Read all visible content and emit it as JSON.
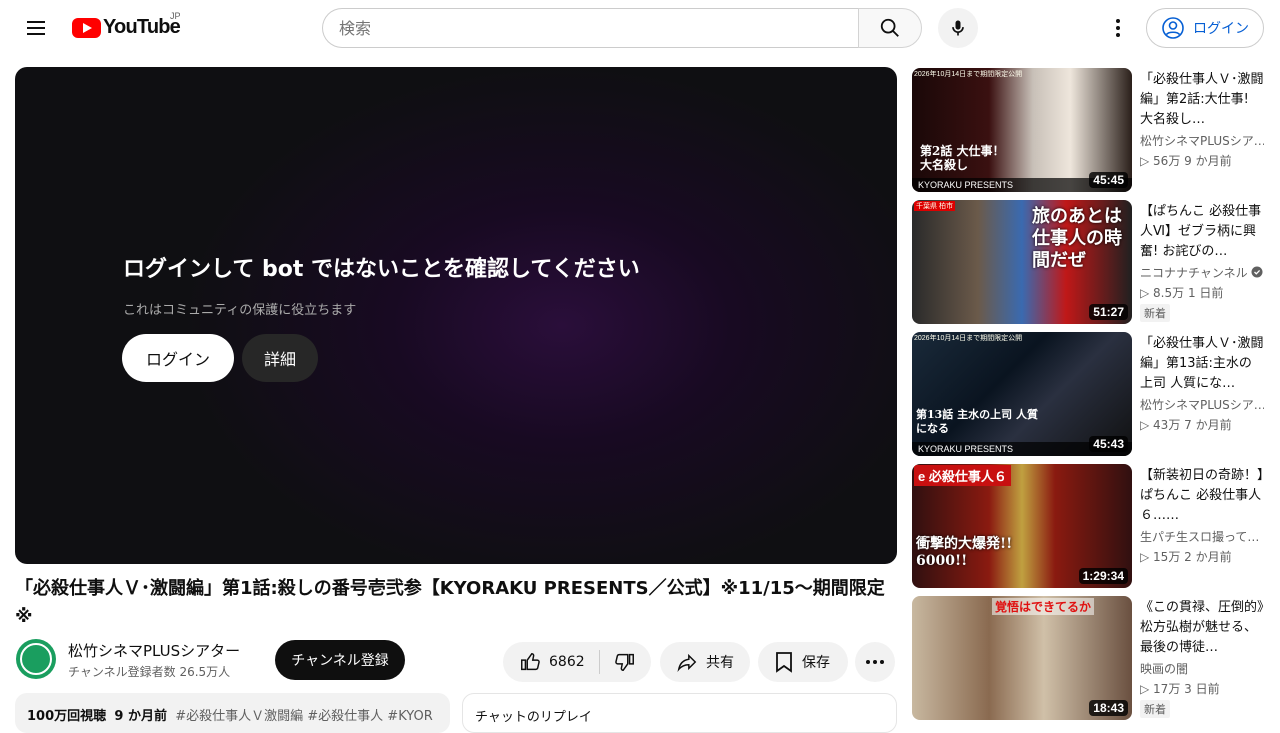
{
  "header": {
    "logo_text": "YouTube",
    "region": "JP",
    "search_placeholder": "検索",
    "login_label": "ログイン"
  },
  "player": {
    "title": "ログインして bot ではないことを確認してください",
    "subtitle": "これはコミュニティの保護に役立ちます",
    "login_label": "ログイン",
    "detail_label": "詳細"
  },
  "video": {
    "title": "「必殺仕事人Ｖ･激闘編」第1話:殺しの番号壱弐参【KYORAKU PRESENTS／公式】※11/15～期間限定※",
    "channel_name": "松竹シネマPLUSシアター",
    "channel_subs": "チャンネル登録者数 26.5万人",
    "subscribe_label": "チャンネル登録",
    "likes": "6862",
    "share_label": "共有",
    "save_label": "保存",
    "description": {
      "views": "100万回視聴",
      "date": "9 か月前",
      "tags": "#必殺仕事人Ｖ激闘編 #必殺仕事人 #KYOR"
    },
    "chat_label": "チャットのリプレイ"
  },
  "recommendations": [
    {
      "title": "「必殺仕事人Ｖ･激闘編」第2話:大仕事! 大名殺し…",
      "channel": "松竹シネマPLUSシア…",
      "meta": "▷ 56万  9 か月前",
      "duration": "45:45",
      "thumb_top": "2026年10月14日まで期間限定公開",
      "thumb_band": "KYORAKU PRESENTS",
      "thumb_text": "第2話 大仕事！大名殺し",
      "badge": ""
    },
    {
      "title": "【ぱちんこ 必殺仕事人Ⅵ】ゼブラ柄に興奮! お詫びの…",
      "channel": "ニコナナチャンネル",
      "meta": "▷ 8.5万  1 日前",
      "duration": "51:27",
      "thumb_top": "千葉県 柏市",
      "thumb_band": "",
      "thumb_text": "旅のあとは仕事人の時間だぜ",
      "badge": "新着"
    },
    {
      "title": "「必殺仕事人Ｖ･激闘編」第13話:主水の上司 人質にな…",
      "channel": "松竹シネマPLUSシア…",
      "meta": "▷ 43万  7 か月前",
      "duration": "45:43",
      "thumb_top": "2026年10月14日まで期間限定公開",
      "thumb_band": "KYORAKU PRESENTS",
      "thumb_text": "第13話 主水の上司 人質になる",
      "badge": ""
    },
    {
      "title": "【新装初日の奇跡！】ぱちんこ 必殺仕事人６……",
      "channel": "生パチ生スロ撮って…",
      "meta": "▷ 15万  2 か月前",
      "duration": "1:29:34",
      "thumb_top": "e 必殺仕事人６",
      "thumb_band": "",
      "thumb_text": "衝撃的大爆発!! 6000!!",
      "badge": ""
    },
    {
      "title": "《この貫禄、圧倒的》松方弘樹が魅せる、最後の博徒…",
      "channel": "映画の闇",
      "meta": "▷ 17万  3 日前",
      "duration": "18:43",
      "thumb_top": "覚悟はできてるか",
      "thumb_band": "",
      "thumb_text": "",
      "badge": "新着"
    }
  ]
}
